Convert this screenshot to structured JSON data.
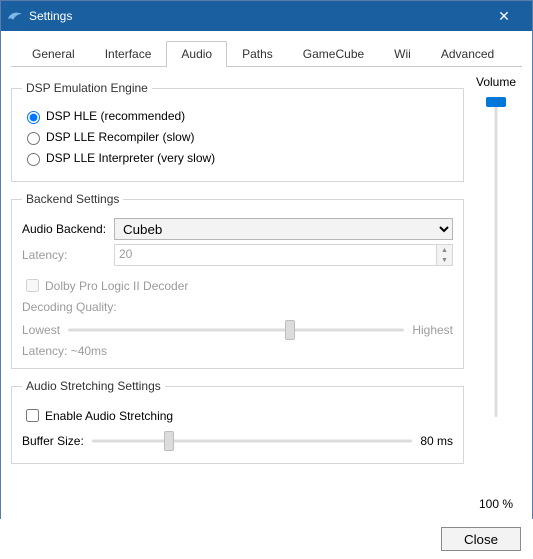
{
  "window": {
    "title": "Settings"
  },
  "tabs": {
    "items": [
      "General",
      "Interface",
      "Audio",
      "Paths",
      "GameCube",
      "Wii",
      "Advanced"
    ],
    "active": "Audio"
  },
  "dsp": {
    "legend": "DSP Emulation Engine",
    "options": {
      "hle": "DSP HLE (recommended)",
      "lle_rec": "DSP LLE Recompiler (slow)",
      "lle_int": "DSP LLE Interpreter (very slow)"
    },
    "selected": "hle"
  },
  "backend": {
    "legend": "Backend Settings",
    "audio_backend_label": "Audio Backend:",
    "audio_backend_value": "Cubeb",
    "latency_label": "Latency:",
    "latency_value": "20",
    "dolby_label": "Dolby Pro Logic II Decoder",
    "decoding_quality_label": "Decoding Quality:",
    "quality_lowest": "Lowest",
    "quality_highest": "Highest",
    "latency_note": "Latency: ~40ms"
  },
  "stretching": {
    "legend": "Audio Stretching Settings",
    "enable_label": "Enable Audio Stretching",
    "buffer_label": "Buffer Size:",
    "buffer_value": "80 ms"
  },
  "volume": {
    "label": "Volume",
    "value_text": "100 %"
  },
  "footer": {
    "close": "Close"
  }
}
